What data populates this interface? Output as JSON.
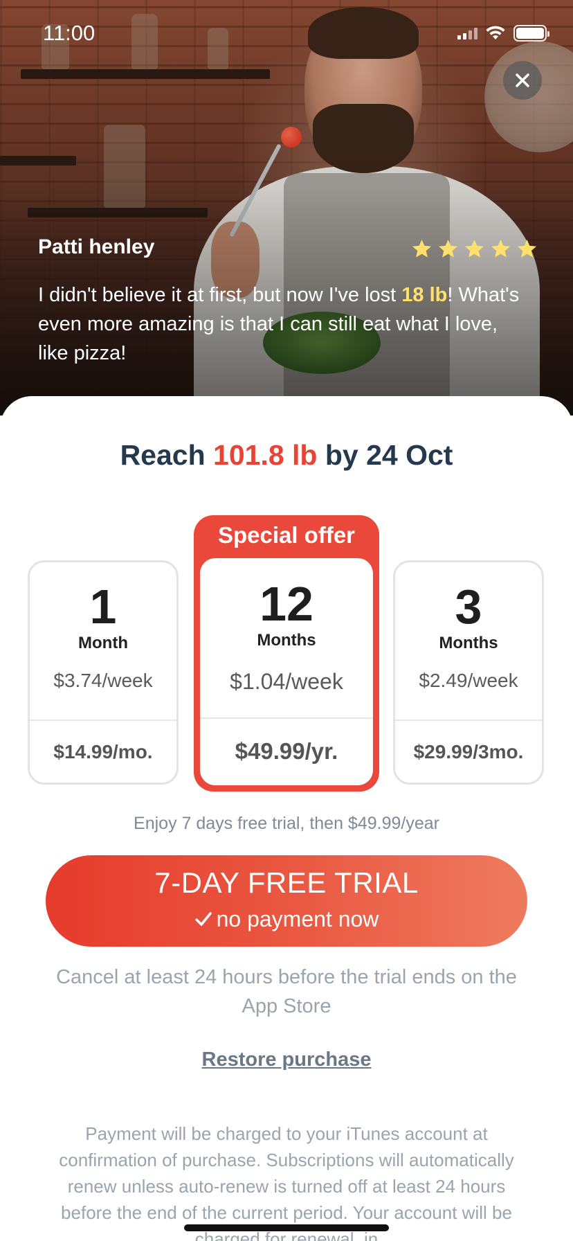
{
  "status_bar": {
    "time": "11:00"
  },
  "testimonial": {
    "name": "Patti henley",
    "rating": 5,
    "text_before": "I didn't believe it at first, but now I've lost ",
    "highlight": "18 lb",
    "text_after": "! What's even more amazing is that I can still eat what I love, like pizza!"
  },
  "goal": {
    "prefix": "Reach ",
    "weight": "101.8 lb",
    "suffix": " by 24 Oct"
  },
  "plans": [
    {
      "num": "1",
      "unit": "Month",
      "weekly": "$3.74/week",
      "total": "$14.99/mo.",
      "featured": false
    },
    {
      "num": "12",
      "unit": "Months",
      "weekly": "$1.04/week",
      "total": "$49.99/yr.",
      "featured": true,
      "badge": "Special offer"
    },
    {
      "num": "3",
      "unit": "Months",
      "weekly": "$2.49/week",
      "total": "$29.99/3mo.",
      "featured": false
    }
  ],
  "trial_note": "Enjoy 7 days free trial, then $49.99/year",
  "cta": {
    "main": "7-DAY FREE TRIAL",
    "sub": "no payment now"
  },
  "cancel_note": "Cancel at least 24 hours before the trial ends on the App Store",
  "restore": "Restore purchase",
  "legal": "Payment will be charged to your iTunes account at confirmation of purchase. Subscriptions will automatically renew unless auto-renew is turned off at least 24 hours before the end of the current period. Your account will be charged for renewal, in",
  "colors": {
    "accent_red": "#ea4233",
    "heading_navy": "#24384e",
    "star_yellow": "#ffe06a"
  }
}
